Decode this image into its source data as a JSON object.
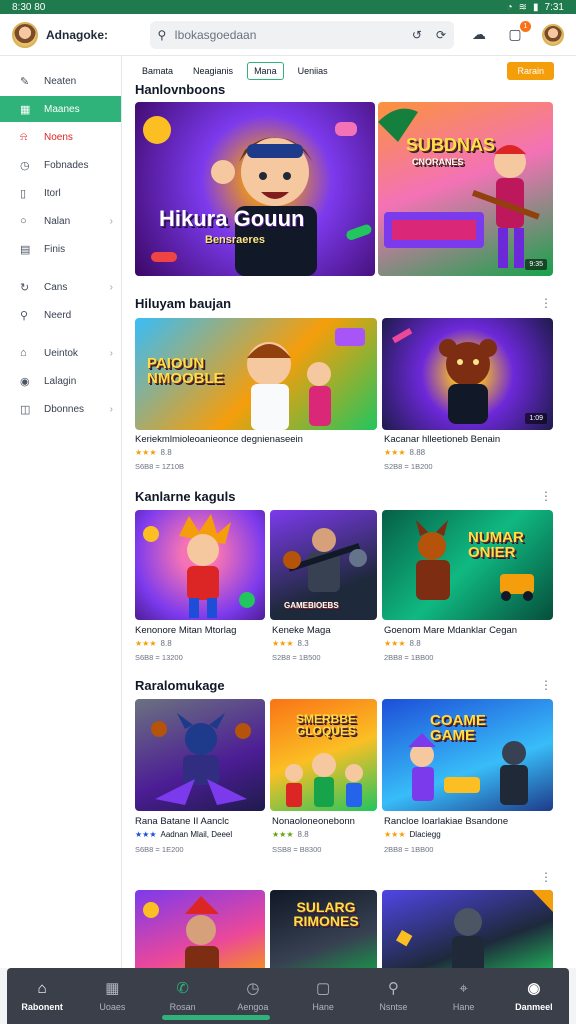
{
  "status_bar": {
    "time": "8:30 80",
    "right_time": "7:31"
  },
  "header": {
    "app_title": "Adnagoke:",
    "search_placeholder": "Ibokasgoedaan"
  },
  "sidebar": {
    "items": [
      {
        "label": "Neaten",
        "icon": "pencil-icon",
        "state": "normal"
      },
      {
        "label": "Maanes",
        "icon": "grid-icon",
        "state": "active"
      },
      {
        "label": "Noens",
        "icon": "bell-icon",
        "state": "alert"
      },
      {
        "label": "Fobnades",
        "icon": "clock-icon",
        "state": "normal"
      },
      {
        "label": "Itorl",
        "icon": "book-icon",
        "state": "normal"
      },
      {
        "label": "Nalan",
        "icon": "circle-icon",
        "state": "normal",
        "chevron": true
      },
      {
        "label": "Finis",
        "icon": "calendar-icon",
        "state": "normal"
      },
      {
        "label": "Cans",
        "icon": "refresh-icon",
        "state": "normal",
        "chevron": true,
        "gap_before": true
      },
      {
        "label": "Neerd",
        "icon": "search-icon",
        "state": "normal"
      },
      {
        "label": "Ueintok",
        "icon": "home-icon",
        "state": "normal",
        "chevron": true,
        "gap_before": true
      },
      {
        "label": "Lalagin",
        "icon": "user-icon",
        "state": "normal"
      },
      {
        "label": "Dbonnes",
        "icon": "box-icon",
        "state": "normal",
        "chevron": true
      }
    ]
  },
  "filters": {
    "chips": [
      "Bamata",
      "Neagianis",
      "Mana",
      "Ueniias"
    ],
    "selected_index": 2,
    "action_label": "Rarain"
  },
  "sections": {
    "s1": {
      "title": "Hanlovnboons"
    },
    "s2": {
      "title": "Hiluyam baujan"
    },
    "s3": {
      "title": "Kanlarne kaguls"
    },
    "s4": {
      "title": "Raralomukage"
    }
  },
  "hero": {
    "title": "Hikura Gouun",
    "subtitle": "Bensraeres",
    "side_art": "SUBDNAS",
    "side_sub": "CNORANES",
    "side_tag": "9:35"
  },
  "row2": [
    {
      "title": "Keriekmlmioleoanieonce degnienaseein",
      "stars": "★★★",
      "rating": "8.8",
      "meta": "S6B8 = 1Z10B",
      "art": "PAIOUN NMOOBLE"
    },
    {
      "title": "Kacanar hlleetioneb Benain",
      "stars": "★★★",
      "rating": "8.88",
      "meta": "S2B8 = 1B200",
      "art": "",
      "tag": "1:09"
    }
  ],
  "row3": [
    {
      "title": "Kenonore Mitan Mtorlag",
      "stars": "★★★",
      "rating": "8.8",
      "meta": "S6B8 = 13200",
      "art": ""
    },
    {
      "title": "Keneke Maga",
      "stars": "★★★",
      "rating": "8.3",
      "meta": "S2B8 = 1B500",
      "art": "GAMEBIOEBS"
    },
    {
      "title": "Goenom Mare Mdanklar Cegan",
      "stars": "★★★",
      "rating": "8.8",
      "meta": "2BB8 = 1BB00",
      "art": "NUMAR ONIER"
    }
  ],
  "row4": [
    {
      "title": "Rana Batane II Aanclc",
      "subtitle": "Aadnan Mlail, Deeel",
      "stars": "★★★",
      "meta": "S6B8 = 1E200",
      "art": ""
    },
    {
      "title": "Nonaoloneonebonn",
      "stars": "★★★",
      "rating": "8.8",
      "meta": "SSB8 = B8300",
      "art": "SMERBBE GLOQUES"
    },
    {
      "title": "Rancloe Ioarlakiae Bsandone",
      "stars": "★★★",
      "subtitle": "Dlaciegg",
      "meta": "2BB8 = 1BB00",
      "art": "COAME GAME"
    }
  ],
  "row5": [
    {
      "art": ""
    },
    {
      "art": "SULARG RIMONES"
    },
    {
      "art": ""
    }
  ],
  "bottom_nav": [
    {
      "label": "Rabonent",
      "icon": "home-icon",
      "active": true
    },
    {
      "label": "Uoaes",
      "icon": "grid-icon"
    },
    {
      "label": "Rosan",
      "icon": "phone-icon",
      "green": true
    },
    {
      "label": "Aengoa",
      "icon": "clock-icon"
    },
    {
      "label": "Hane",
      "icon": "square-icon"
    },
    {
      "label": "Nsntse",
      "icon": "search-icon"
    },
    {
      "label": "Hane",
      "icon": "pin-icon"
    },
    {
      "label": "Danmeel",
      "icon": "user-icon",
      "active": true
    }
  ]
}
